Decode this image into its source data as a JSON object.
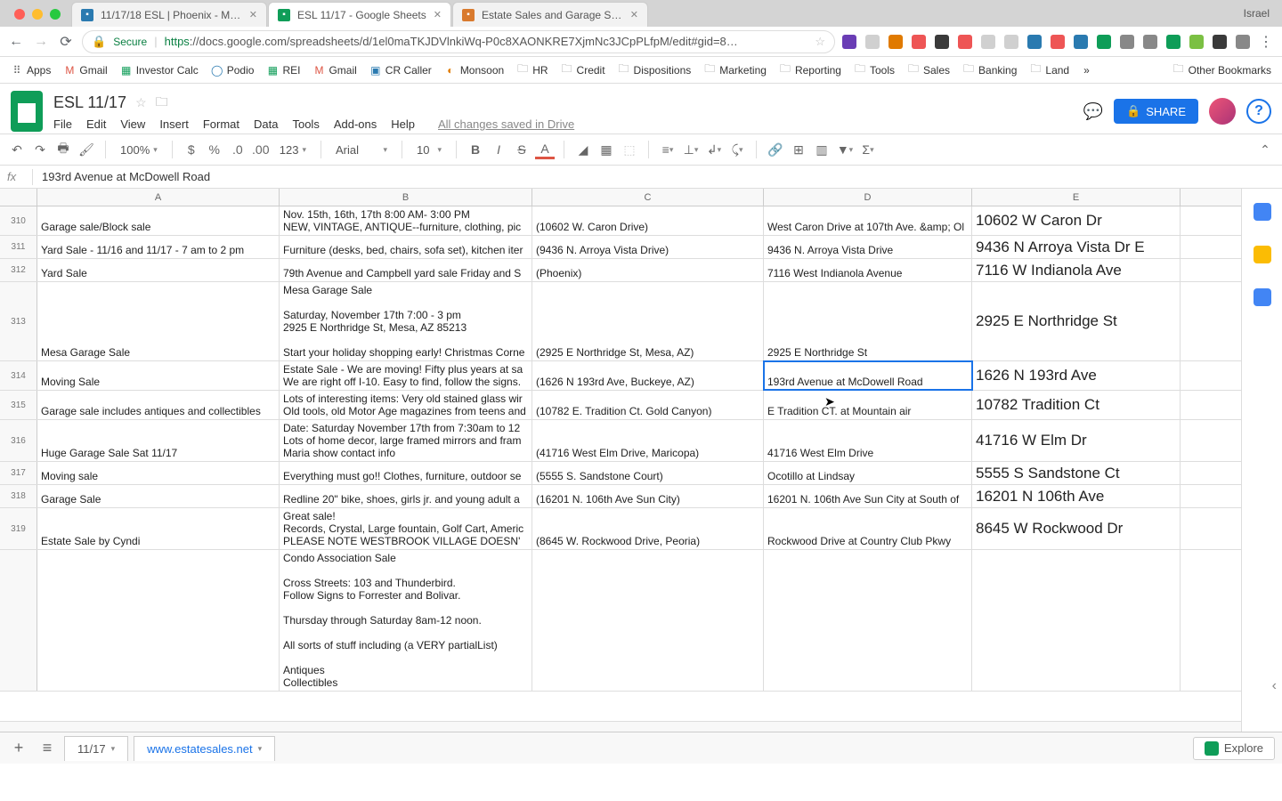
{
  "os_user": "Israel",
  "browser_tabs": [
    {
      "icon_color": "#2a7ab0",
      "label": "11/17/18 ESL | Phoenix - Mark…"
    },
    {
      "icon_color": "#0f9d58",
      "label": "ESL 11/17 - Google Sheets"
    },
    {
      "icon_color": "#d97a2e",
      "label": "Estate Sales and Garage Sales…"
    }
  ],
  "url": {
    "secure": "Secure",
    "prefix": "https",
    "rest": "://docs.google.com/spreadsheets/d/1el0maTKJDVlnkiWq-P0c8XAONKRE7XjmNc3JCpPLfpM/edit#gid=8…"
  },
  "ext_colors": [
    "#6a3db5",
    "#d0d0d0",
    "#e07a00",
    "#e55",
    "#3a3a3a",
    "#e55",
    "#d0d0d0",
    "#d0d0d0",
    "#2a7ab0",
    "#e55",
    "#2a7ab0",
    "#0f9d58",
    "#888",
    "#888",
    "#0f9d58",
    "#7bc043",
    "#3a3a3a",
    "#888"
  ],
  "bookmarks": [
    {
      "icon": "⠿",
      "icon_color": "#666",
      "label": "Apps"
    },
    {
      "icon": "M",
      "icon_color": "#d54",
      "label": "Gmail"
    },
    {
      "icon": "▦",
      "icon_color": "#0f9d58",
      "label": "Investor Calc"
    },
    {
      "icon": "◯",
      "icon_color": "#2a7ab0",
      "label": "Podio"
    },
    {
      "icon": "▦",
      "icon_color": "#0f9d58",
      "label": "REI"
    },
    {
      "icon": "M",
      "icon_color": "#d54",
      "label": "Gmail"
    },
    {
      "icon": "▣",
      "icon_color": "#2a7ab0",
      "label": "CR Caller"
    },
    {
      "icon": "◐",
      "icon_color": "#e07a00",
      "label": "Monsoon"
    },
    {
      "icon": "🗀",
      "icon_color": "#888",
      "label": "HR"
    },
    {
      "icon": "🗀",
      "icon_color": "#888",
      "label": "Credit"
    },
    {
      "icon": "🗀",
      "icon_color": "#888",
      "label": "Dispositions"
    },
    {
      "icon": "🗀",
      "icon_color": "#888",
      "label": "Marketing"
    },
    {
      "icon": "🗀",
      "icon_color": "#888",
      "label": "Reporting"
    },
    {
      "icon": "🗀",
      "icon_color": "#888",
      "label": "Tools"
    },
    {
      "icon": "🗀",
      "icon_color": "#888",
      "label": "Sales"
    },
    {
      "icon": "🗀",
      "icon_color": "#888",
      "label": "Banking"
    },
    {
      "icon": "🗀",
      "icon_color": "#888",
      "label": "Land"
    }
  ],
  "other_bookmarks": "Other Bookmarks",
  "doc": {
    "title": "ESL 11/17",
    "menus": [
      "File",
      "Edit",
      "View",
      "Insert",
      "Format",
      "Data",
      "Tools",
      "Add-ons",
      "Help"
    ],
    "saved": "All changes saved in Drive",
    "share": "SHARE"
  },
  "toolbar": {
    "zoom": "100%",
    "font": "Arial",
    "size": "10",
    "num": "123"
  },
  "formula": "193rd Avenue at McDowell Road",
  "columns": [
    "A",
    "B",
    "C",
    "D",
    "E"
  ],
  "rows": [
    {
      "n": "310",
      "a": "Garage sale/Block sale",
      "b": "Nov. 15th, 16th, 17th 8:00 AM- 3:00 PM\nNEW, VINTAGE, ANTIQUE--furniture, clothing, pic",
      "c": "(10602 W. Caron Drive)",
      "d": "West Caron Drive at 107th Ave. &amp; Ol",
      "e": "10602 W Caron Dr"
    },
    {
      "n": "311",
      "a": "Yard Sale - 11/16 and 11/17 - 7 am to 2 pm",
      "b": "Furniture (desks, bed, chairs, sofa set), kitchen iter",
      "c": "(9436 N. Arroya Vista Drive)",
      "d": "9436 N. Arroya Vista Drive",
      "e": "9436 N Arroya Vista Dr E"
    },
    {
      "n": "312",
      "a": "Yard Sale",
      "b": "79th Avenue and Campbell yard sale Friday and S",
      "c": "(Phoenix)",
      "d": "7116 West Indianola Avenue",
      "e": "7116 W Indianola Ave"
    },
    {
      "n": "313",
      "a": "Mesa Garage Sale",
      "b": "Mesa Garage Sale\n\nSaturday, November 17th 7:00 - 3 pm\n2925 E Northridge St, Mesa, AZ 85213\n\nStart your holiday shopping early! Christmas Corne",
      "c": "(2925 E Northridge St, Mesa, AZ)",
      "d": "2925 E Northridge St",
      "e": "2925 E Northridge St"
    },
    {
      "n": "314",
      "a": "Moving Sale",
      "b": "Estate Sale -  We are moving! Fifty plus years at sa\nWe are right off I-10. Easy to find, follow the signs.",
      "c": "(1626 N 193rd Ave, Buckeye, AZ)",
      "d": "193rd Avenue at McDowell Road",
      "e": "1626 N 193rd Ave"
    },
    {
      "n": "315",
      "a": "Garage sale includes antiques and collectibles",
      "b": "Lots of interesting items: Very old stained glass wir\nOld tools, old Motor Age magazines from teens and",
      "c": "(10782 E. Tradition Ct. Gold Canyon)",
      "d": "E Tradition CT. at Mountain air",
      "e": "10782 Tradition Ct"
    },
    {
      "n": "316",
      "a": "Huge Garage Sale Sat 11/17",
      "b": "Date:  Saturday November 17th from 7:30am to 12\nLots of home decor, large framed mirrors and fram\nMaria  show contact info",
      "c": "(41716 West Elm Drive, Maricopa)",
      "d": "41716 West Elm Drive",
      "e": "41716 W Elm Dr"
    },
    {
      "n": "317",
      "a": "Moving sale",
      "b": "Everything must go!!  Clothes, furniture, outdoor se",
      "c": "(5555 S. Sandstone Court)",
      "d": "Ocotillo at Lindsay",
      "e": "5555 S Sandstone Ct"
    },
    {
      "n": "318",
      "a": "Garage Sale",
      "b": "Redline 20\" bike,  shoes, girls jr. and young adult a",
      "c": "(16201 N. 106th Ave Sun City)",
      "d": "16201 N. 106th Ave Sun City at South of",
      "e": "16201 N 106th Ave"
    },
    {
      "n": "319",
      "a": "Estate Sale by Cyndi",
      "b": "Great sale!\nRecords, Crystal, Large fountain, Golf Cart, Americ\nPLEASE NOTE WESTBROOK VILLAGE DOESN'",
      "c": "(8645 W. Rockwood Drive, Peoria)",
      "d": "Rockwood Drive at Country Club Pkwy",
      "e": "8645 W Rockwood Dr"
    },
    {
      "n": "",
      "a": "",
      "b": "Condo Association Sale\n\nCross Streets: 103 and Thunderbird.\nFollow Signs to Forrester and Bolivar.\n\nThursday through Saturday 8am-12 noon.\n\nAll sorts of stuff including (a VERY partialList)\n\nAntiques\nCollectibles",
      "c": "",
      "d": "",
      "e": ""
    }
  ],
  "active": {
    "row": 4,
    "col": "d"
  },
  "sheets": [
    {
      "name": "11/17",
      "active": true
    },
    {
      "name": "www.estatesales.net",
      "active": false
    }
  ],
  "explore": "Explore",
  "side_colors": [
    "#4285f4",
    "#fbbc04",
    "#4285f4"
  ]
}
